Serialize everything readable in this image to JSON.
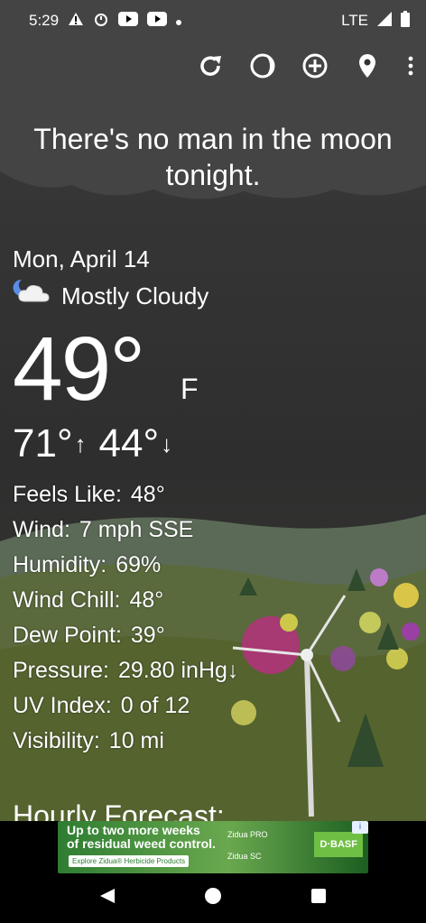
{
  "status_bar": {
    "time": "5:29",
    "network": "LTE",
    "icons": [
      "warning-icon",
      "alarm-icon",
      "youtube-icon",
      "youtube-icon",
      "dot-icon"
    ]
  },
  "toolbar": {
    "icons": [
      "refresh-icon",
      "moon-phase-icon",
      "add-location-icon",
      "location-pin-icon",
      "more-vert-icon"
    ]
  },
  "tagline": {
    "line1": "There's no man in the moon",
    "line2": "tonight."
  },
  "weather": {
    "date": "Mon, April 14",
    "condition": "Mostly Cloudy",
    "condition_icon": "partly-cloudy-night-icon",
    "temperature": "49°",
    "unit": "F",
    "high": "71°",
    "low": "44°",
    "details": [
      {
        "label": "Feels Like:",
        "value": "48°"
      },
      {
        "label": "Wind:",
        "value": "7 mph SSE"
      },
      {
        "label": "Humidity:",
        "value": "69%"
      },
      {
        "label": "Wind Chill:",
        "value": "48°"
      },
      {
        "label": "Dew Point:",
        "value": "39°"
      },
      {
        "label": "Pressure:",
        "value": "29.80 inHg↓"
      },
      {
        "label": "UV Index:",
        "value": "0 of 12"
      },
      {
        "label": "Visibility:",
        "value": "10 mi"
      }
    ]
  },
  "hourly": {
    "heading": "Hourly Forecast:"
  },
  "ad": {
    "headline_line1": "Up to two more weeks",
    "headline_line2": "of residual weed control.",
    "cta": "Explore Zidua® Herbicide Products",
    "product1": "Zidua PRO",
    "product2": "Zidua SC",
    "brand": "D·BASF",
    "info": "i"
  },
  "colors": {
    "sky_top": "#3a3a3a",
    "hill": "#5f6b4a",
    "ad_green": "#2e7d32"
  }
}
